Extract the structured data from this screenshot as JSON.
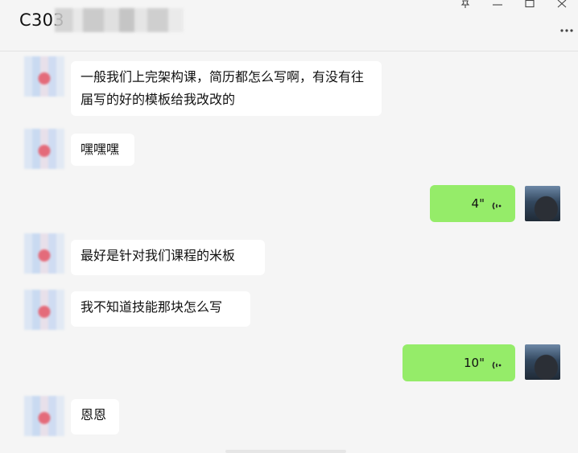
{
  "window": {
    "title": "C303"
  },
  "messages": [
    {
      "sender": "other",
      "text": "一般我们上完架构课，简历都怎么写啊，有没有往届写的好的模板给我改改的"
    },
    {
      "sender": "other",
      "text": "嘿嘿嘿"
    },
    {
      "sender": "self",
      "type": "voice",
      "duration": "4\""
    },
    {
      "sender": "other",
      "text": "最好是针对我们课程的米板"
    },
    {
      "sender": "other",
      "text": "我不知道技能那块怎么写"
    },
    {
      "sender": "self",
      "type": "voice",
      "duration": "10\""
    },
    {
      "sender": "other",
      "text": "恩恩"
    }
  ],
  "icons": {
    "pin": "pin-icon",
    "minimize": "minimize-icon",
    "maximize": "maximize-icon",
    "close": "close-icon",
    "more": "more-icon",
    "voice": "voice-wave-icon"
  },
  "colors": {
    "self_bubble": "#95ec69",
    "other_bubble": "#ffffff",
    "background": "#f5f5f5"
  }
}
